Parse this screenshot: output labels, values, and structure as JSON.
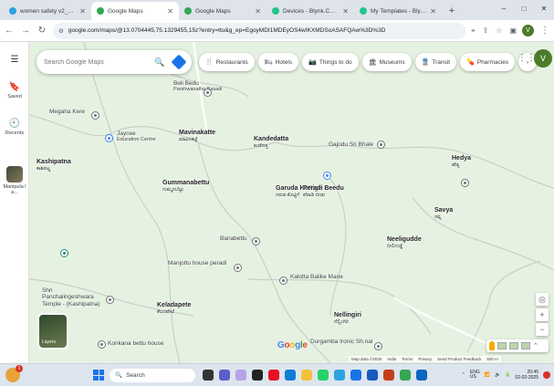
{
  "browser": {
    "tabs": [
      {
        "title": "women safety v2_bot",
        "favicon_color": "#2aa3e0",
        "active": false
      },
      {
        "title": "Google Maps",
        "favicon_color": "#34a853",
        "active": true
      },
      {
        "title": "Google Maps",
        "favicon_color": "#34a853",
        "active": false
      },
      {
        "title": "Devices - Blynk.Console",
        "favicon_color": "#23c48e",
        "active": false
      },
      {
        "title": "My Templates - Blynk.Consol",
        "favicon_color": "#23c48e",
        "active": false
      }
    ],
    "new_tab": "+",
    "window_controls": [
      "–",
      "□",
      "✕"
    ],
    "url": "google.com/maps/@13.0704445,75.1329455,15z?entry=ttu&g_ep=EgoyMDI1MDEyOS4wIKXMDSoASAFQAw%3D%3D",
    "profile_initial": "V"
  },
  "rail": {
    "menu_icon": "hamburger-icon",
    "saved_label": "Saved",
    "recents_label": "Recents",
    "recent_place_label": "Manipula l a..."
  },
  "search": {
    "placeholder": "Search Google Maps"
  },
  "chips": [
    {
      "label": "Restaurants",
      "icon": "🍴"
    },
    {
      "label": "Hotels",
      "icon": "🛏"
    },
    {
      "label": "Things to do",
      "icon": "📷"
    },
    {
      "label": "Museums",
      "icon": "🏛"
    },
    {
      "label": "Transit",
      "icon": "🚆"
    },
    {
      "label": "Pharmacies",
      "icon": "💊"
    }
  ],
  "account_initial": "V",
  "map": {
    "places": {
      "beli_bedu": {
        "name": "Beli Bedu",
        "kn": "Parshwanatha Basadi"
      },
      "megaha_kere": {
        "name": "Megaha Kere",
        "kn": ""
      },
      "jaycee": {
        "name": "Jaycee",
        "kn": "Education Centre"
      },
      "maviinakatte": {
        "name": "Mavinakatte",
        "kn": "ಮಾವಿನಕಟ್ಟೆ"
      },
      "kandedatta": {
        "name": "Kandedatta",
        "kn": "ಕಂಡೆದತ್ತ"
      },
      "gajoda": {
        "name": "Gajodu Sri Bhale",
        "kn": ""
      },
      "hedya": {
        "name": "Hedya",
        "kn": "ಹೆಡ್ಯ"
      },
      "kashipatna": {
        "name": "Kashipatna",
        "kn": "ಕಾಶಿಪಟ್ಣ"
      },
      "gummanabettu": {
        "name": "Gummanabettu",
        "kn": "ಗುಮ್ಮನಬೆಟ್ಟು"
      },
      "garuda_kottige": {
        "name": "Garuda Kottige",
        "kn": "ಗರುಡ ಕೊಟ್ಟಿಗೆ"
      },
      "peradi_beedu": {
        "name": "Peradi Beedu",
        "kn": "ಪೆರಾಡಿ ಬೀಡು"
      },
      "savya": {
        "name": "Savya",
        "kn": "ಸವ್ಯ"
      },
      "banabettu": {
        "name": "Banabettu",
        "kn": "ಬನಬೆಟ್ಟು"
      },
      "neeligudde": {
        "name": "Neeligudde",
        "kn": "ನೀಲಿಗುಡ್ಡೆ"
      },
      "manjottu": {
        "name": "Manjottu house peradi",
        "kn": ""
      },
      "sri_panchalingeshwara": {
        "name": "Shri Panchalingeshwara Temple - (Kashipatna)",
        "kn": ""
      },
      "kalotta": {
        "name": "Kalotta Balike Mane",
        "kn": ""
      },
      "keladapete": {
        "name": "Keladapete",
        "kn": "ಕೆಲದಪೇಟೆ"
      },
      "nellingiri": {
        "name": "Nellingiri",
        "kn": "ನೆಲ್ಲಿಂಗಿರಿ"
      },
      "konkana": {
        "name": "Konkana bettu house",
        "kn": ""
      },
      "durgamba": {
        "name": "Durgamba Ironic Sh.nal",
        "kn": ""
      }
    },
    "layers_label": "Layers",
    "google_logo": "Google",
    "footer": [
      "Map data ©2025",
      "India",
      "Terms",
      "Privacy",
      "Send Product Feedback",
      "500 m"
    ]
  },
  "taskbar": {
    "search_label": "Search",
    "weather_badge": "1",
    "lang": "ENG\nUS",
    "time": "20:45",
    "date": "02-02-2025"
  }
}
